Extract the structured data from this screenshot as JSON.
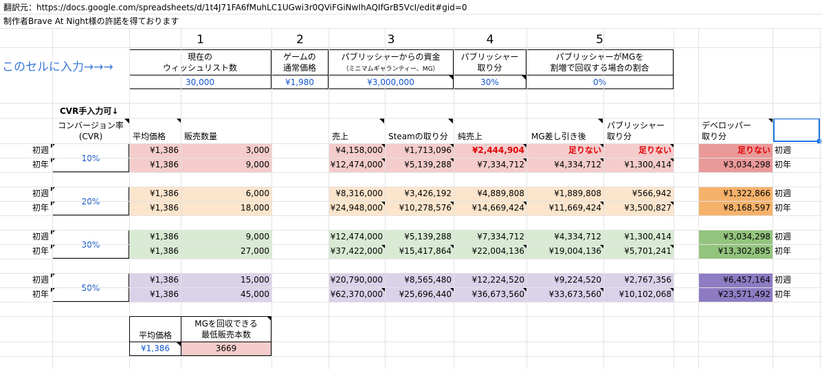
{
  "source_line": "翻訳元：https://docs.google.com/spreadsheets/d/1t4J71FA6fMuhLC1UGwi3r0QViFGiNwIhAQIfGrB5VcI/edit#gid=0",
  "credit_line": "制作者Brave At Night様の許諾を得ております",
  "input_hint": "このセルに入力→→→",
  "inputs": [
    {
      "num": "1",
      "label1": "現在の",
      "label2": "ウィッシュリスト数",
      "value": "30,000"
    },
    {
      "num": "2",
      "label1": "ゲームの",
      "label2": "通常価格",
      "value": "¥1,980"
    },
    {
      "num": "3",
      "label1": "パブリッシャーからの資金",
      "label2": "（ミニマムギャランティー、MG）",
      "value": "¥3,000,000"
    },
    {
      "num": "4",
      "label1": "パブリッシャー",
      "label2": "取り分",
      "value": "30%"
    },
    {
      "num": "5",
      "label1": "パブリッシャーがMGを",
      "label2": "割増で回収する場合の割合",
      "value": "0%"
    }
  ],
  "cvr_note": "CVR手入力可↓",
  "headers": {
    "cvr1": "コンバージョン率",
    "cvr2": "(CVR)",
    "avg_price": "平均価格",
    "sales_qty": "販売数量",
    "revenue": "売上",
    "steam_cut": "Steamの取り分",
    "net_revenue": "純売上",
    "after_mg": "MG差し引き後",
    "pub1": "パブリッシャー",
    "pub2": "取り分",
    "dev1": "デベロッパー",
    "dev2": "取り分"
  },
  "groups": [
    {
      "cvr": "10%",
      "rows": [
        {
          "period": "初週",
          "avg": "¥1,386",
          "qty": "3,000",
          "revenue": "¥4,158,000",
          "steam": "¥1,713,096",
          "net": "¥2,444,904",
          "after_mg": "足りない",
          "pub": "足りない",
          "dev": "足りない",
          "period_right": "初週"
        },
        {
          "period": "初年",
          "avg": "¥1,386",
          "qty": "9,000",
          "revenue": "¥12,474,000",
          "steam": "¥5,139,288",
          "net": "¥7,334,712",
          "after_mg": "¥4,334,712",
          "pub": "¥1,300,414",
          "dev": "¥3,034,298",
          "period_right": "初年"
        }
      ]
    },
    {
      "cvr": "20%",
      "rows": [
        {
          "period": "初週",
          "avg": "¥1,386",
          "qty": "6,000",
          "revenue": "¥8,316,000",
          "steam": "¥3,426,192",
          "net": "¥4,889,808",
          "after_mg": "¥1,889,808",
          "pub": "¥566,942",
          "dev": "¥1,322,866",
          "period_right": "初週"
        },
        {
          "period": "初年",
          "avg": "¥1,386",
          "qty": "18,000",
          "revenue": "¥24,948,000",
          "steam": "¥10,278,576",
          "net": "¥14,669,424",
          "after_mg": "¥11,669,424",
          "pub": "¥3,500,827",
          "dev": "¥8,168,597",
          "period_right": "初年"
        }
      ]
    },
    {
      "cvr": "30%",
      "rows": [
        {
          "period": "初週",
          "avg": "¥1,386",
          "qty": "9,000",
          "revenue": "¥12,474,000",
          "steam": "¥5,139,288",
          "net": "¥7,334,712",
          "after_mg": "¥4,334,712",
          "pub": "¥1,300,414",
          "dev": "¥3,034,298",
          "period_right": "初週"
        },
        {
          "period": "初年",
          "avg": "¥1,386",
          "qty": "27,000",
          "revenue": "¥37,422,000",
          "steam": "¥15,417,864",
          "net": "¥22,004,136",
          "after_mg": "¥19,004,136",
          "pub": "¥5,701,241",
          "dev": "¥13,302,895",
          "period_right": "初年"
        }
      ]
    },
    {
      "cvr": "50%",
      "rows": [
        {
          "period": "初週",
          "avg": "¥1,386",
          "qty": "15,000",
          "revenue": "¥20,790,000",
          "steam": "¥8,565,480",
          "net": "¥12,224,520",
          "after_mg": "¥9,224,520",
          "pub": "¥2,767,356",
          "dev": "¥6,457,164",
          "period_right": "初週"
        },
        {
          "period": "初年",
          "avg": "¥1,386",
          "qty": "45,000",
          "revenue": "¥62,370,000",
          "steam": "¥25,696,440",
          "net": "¥36,673,560",
          "after_mg": "¥33,673,560",
          "pub": "¥10,102,068",
          "dev": "¥23,571,492",
          "period_right": "初年"
        }
      ]
    }
  ],
  "summary": {
    "avg_label": "平均価格",
    "min_label1": "MGを回収できる",
    "min_label2": "最低販売本数",
    "avg_value": "¥1,386",
    "min_value": "3669"
  },
  "colors": {
    "group_bg": [
      "#f4cccc",
      "#fce5cd",
      "#d9ead3",
      "#d9d2e9"
    ],
    "dev_bg": [
      "#ea9999",
      "#f6b26b",
      "#93c47d",
      "#8e7cc3"
    ],
    "input_text": "#1155cc",
    "hint_text": "#3c78d8",
    "negative_text": "#e00000",
    "selection": "#1a73e8"
  }
}
